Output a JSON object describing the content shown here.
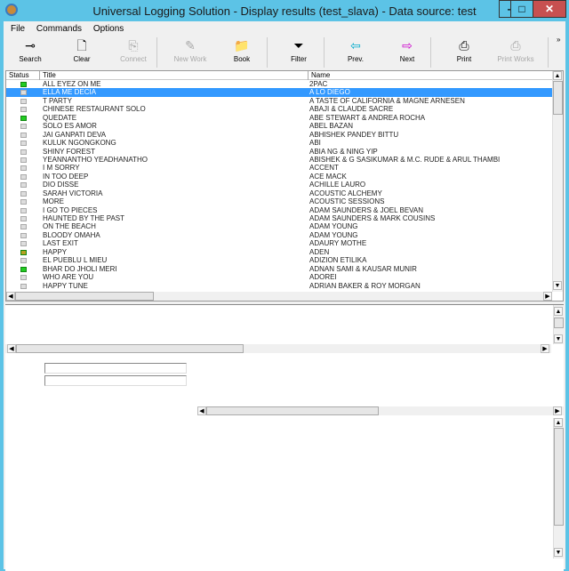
{
  "window": {
    "title": "Universal Logging Solution  -  Display results (test_slava) - Data source: test",
    "min": "–",
    "max": "□",
    "close": "✕"
  },
  "menu": [
    "File",
    "Commands",
    "Options"
  ],
  "toolbar": [
    {
      "label": "Search",
      "icon": "search-icon",
      "glyph": "⊸",
      "enabled": true
    },
    {
      "label": "Clear",
      "icon": "clear-document-icon",
      "glyph": "🗋",
      "enabled": true
    },
    {
      "label": "Connect",
      "icon": "connect-icon",
      "glyph": "⎘",
      "enabled": false
    },
    {
      "label": "New Work",
      "icon": "new-work-icon",
      "glyph": "✎",
      "enabled": false
    },
    {
      "label": "Book",
      "icon": "book-folder-icon",
      "glyph": "📁",
      "enabled": true
    },
    {
      "label": "Filter",
      "icon": "filter-icon",
      "glyph": "⏷",
      "enabled": true
    },
    {
      "label": "Prev.",
      "icon": "arrow-left-icon",
      "glyph": "⇦",
      "enabled": true
    },
    {
      "label": "Next",
      "icon": "arrow-right-icon",
      "glyph": "⇨",
      "enabled": true
    },
    {
      "label": "Print",
      "icon": "printer-icon",
      "glyph": "⎙",
      "enabled": true
    },
    {
      "label": "Print Works",
      "icon": "print-works-icon",
      "glyph": "⎙",
      "enabled": false
    }
  ],
  "overflow": "»",
  "list": {
    "columns": [
      "Status",
      "Title",
      "Name"
    ],
    "selected_index": 1,
    "rows": [
      {
        "status": "green",
        "title": "ALL EYEZ ON ME",
        "name": "2PAC"
      },
      {
        "status": "gray",
        "title": "ELLA ME DECIA",
        "name": "A LO DIEGO"
      },
      {
        "status": "gray",
        "title": "T PARTY",
        "name": "A TASTE OF CALIFORNIA & MAGNE ARNESEN"
      },
      {
        "status": "gray",
        "title": "CHINESE RESTAURANT SOLO",
        "name": "ABAJI & CLAUDE SACRE"
      },
      {
        "status": "green",
        "title": "QUEDATE",
        "name": "ABE STEWART & ANDREA ROCHA"
      },
      {
        "status": "gray",
        "title": "SOLO ES AMOR",
        "name": "ABEL BAZAN"
      },
      {
        "status": "gray",
        "title": "JAI GANPATI DEVA",
        "name": "ABHISHEK PANDEY BITTU"
      },
      {
        "status": "gray",
        "title": "KULUK NGONGKONG",
        "name": "ABI"
      },
      {
        "status": "gray",
        "title": "SHINY FOREST",
        "name": "ABIA NG & NING YIP"
      },
      {
        "status": "gray",
        "title": "YEANNANTHO YEADHANATHO",
        "name": "ABISHEK & G SASIKUMAR & M.C. RUDE & ARUL THAMBI"
      },
      {
        "status": "gray",
        "title": "I M SORRY",
        "name": "ACCENT"
      },
      {
        "status": "gray",
        "title": "IN TOO DEEP",
        "name": "ACE MACK"
      },
      {
        "status": "gray",
        "title": "DIO DISSE",
        "name": "ACHILLE LAURO"
      },
      {
        "status": "gray",
        "title": "SARAH VICTORIA",
        "name": "ACOUSTIC ALCHEMY"
      },
      {
        "status": "gray",
        "title": "MORE",
        "name": "ACOUSTIC SESSIONS"
      },
      {
        "status": "gray",
        "title": "I GO TO PIECES",
        "name": "ADAM SAUNDERS & JOEL BEVAN"
      },
      {
        "status": "gray",
        "title": "HAUNTED BY THE PAST",
        "name": "ADAM SAUNDERS & MARK COUSINS"
      },
      {
        "status": "gray",
        "title": "ON THE BEACH",
        "name": "ADAM YOUNG"
      },
      {
        "status": "gray",
        "title": "BLOODY OMAHA",
        "name": "ADAM YOUNG"
      },
      {
        "status": "gray",
        "title": "LAST EXIT",
        "name": "ADAURY MOTHE"
      },
      {
        "status": "orange",
        "title": "HAPPY",
        "name": "ADEN"
      },
      {
        "status": "gray",
        "title": "EL PUEBLU L MIEU",
        "name": "ADIZION ETILIKA"
      },
      {
        "status": "green",
        "title": "BHAR DO JHOLI MERI",
        "name": "ADNAN SAMI & KAUSAR MUNIR"
      },
      {
        "status": "gray",
        "title": "WHO ARE YOU",
        "name": "ADOREI"
      },
      {
        "status": "gray",
        "title": "HAPPY TUNE",
        "name": "ADRIAN BAKER & ROY MORGAN"
      }
    ]
  },
  "fields": {
    "field1": "",
    "field2": ""
  },
  "colors": {
    "selection": "#3399ff",
    "frame": "#5cc3e6",
    "status_green": "#22cc22"
  }
}
